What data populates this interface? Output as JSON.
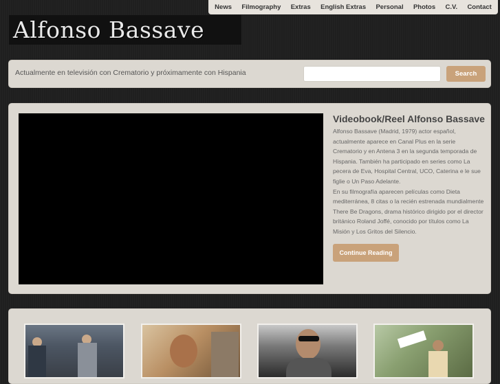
{
  "nav": {
    "items": [
      "News",
      "Filmography",
      "Extras",
      "English Extras",
      "Personal",
      "Photos",
      "C.V.",
      "Contact"
    ]
  },
  "logo": {
    "text": "Alfonso Bassave"
  },
  "bar": {
    "tagline": "Actualmente en televisión con Crematorio y próximamente con Hispania",
    "search_placeholder": "",
    "search_label": "Search"
  },
  "feature": {
    "title": "Videobook/Reel Alfonso Bassave",
    "paragraphs": [
      "Alfonso Bassave (Madrid, 1979) actor español, actualmente aparece en Canal Plus en la serie Crematorio y en Antena 3 en la segunda temporada de Hispania. También ha participado en series como La pecera de Eva, Hospital Central, UCO, Caterina e le sue figlie o Un Paso Adelante.",
      "En su filmografía aparecen películas como Dieta mediterránea, 8 citas o la recién estrenada mundialmente There Be Dragons, drama histórico dirigido por el director británico Roland Joffé, conocido por títulos como La Misión y Los Gritos del Silencio."
    ],
    "button_label": "Continue Reading"
  },
  "colors": {
    "accent": "#c9a27a",
    "panel": "#dcd8d1",
    "background": "#1f1f1f"
  }
}
